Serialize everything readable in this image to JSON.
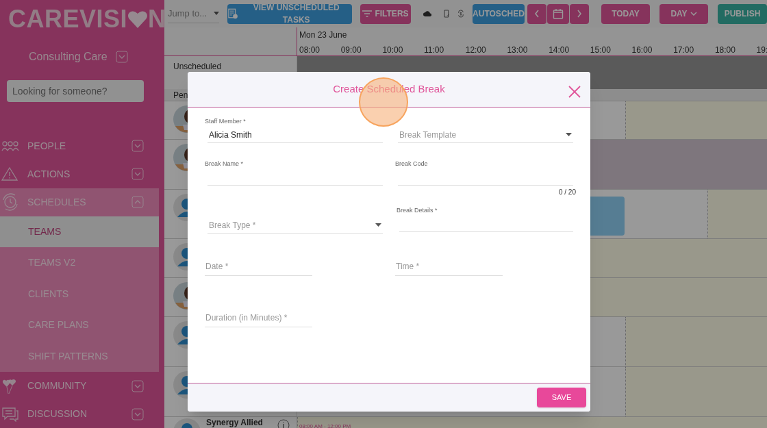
{
  "logo": {
    "before": "CAREVISI",
    "after": "N"
  },
  "organisation": "Consulting Care",
  "search": {
    "placeholder": "Looking for someone?"
  },
  "sidebar": {
    "items": [
      {
        "label": "PEOPLE",
        "kind": "people",
        "expanded": false
      },
      {
        "label": "ACTIONS",
        "kind": "warning",
        "expanded": false
      },
      {
        "label": "SCHEDULES",
        "kind": "clock",
        "expanded": true,
        "children": [
          {
            "label": "TEAMS",
            "selected": true
          },
          {
            "label": "TEAMS V2",
            "selected": false
          },
          {
            "label": "CLIENTS",
            "selected": false
          },
          {
            "label": "CARE PLANS",
            "selected": false
          },
          {
            "label": "SHIFT PATTERNS",
            "selected": false
          }
        ]
      },
      {
        "label": "COMMUNITY",
        "kind": "balloon",
        "expanded": false
      },
      {
        "label": "DISCUSSION",
        "kind": "chat",
        "expanded": false
      }
    ]
  },
  "toolbar": {
    "jump": {
      "placeholder": "Jump to..."
    },
    "unscheduled": "VIEW UNSCHEDULED TASKS",
    "filters": "FILTERS",
    "autosched": "AUTOSCHED",
    "today": "TODAY",
    "view": "DAY",
    "publish": "PUBLISH"
  },
  "schedule": {
    "date": "Mon 23 June",
    "hours": [
      "08:00",
      "09:00",
      "10:00",
      "11:00",
      "12:00",
      "13:00",
      "14:00",
      "15:00",
      "16:00",
      "17:00",
      "18:00",
      "19:"
    ],
    "unscheduled": "Unscheduled",
    "pending": "Pen",
    "rows": [
      {
        "lane": {
          "kind": "open"
        }
      },
      {
        "lane": {
          "kind": "leave"
        }
      },
      {
        "avatar": {
          "kind": "generic"
        },
        "lane": {
          "kind": "shift"
        }
      },
      {
        "avatar": {
          "kind": "generic"
        },
        "lane": {
          "kind": "available"
        }
      },
      {
        "lane": {
          "kind": "available"
        }
      },
      {
        "avatar": {
          "kind": "generic"
        },
        "lane": {
          "kind": "open"
        }
      },
      {
        "avatar": {
          "kind": "generic"
        },
        "lane": {
          "kind": "open"
        }
      },
      {
        "avatar": {
          "kind": "generic"
        },
        "lane": {
          "kind": "available"
        },
        "name": "Synergy Allied",
        "time": "08:00 AM - 12:00 PM"
      }
    ]
  },
  "dialog": {
    "title": "Create Scheduled Break",
    "save": "SAVE",
    "fields": [
      {
        "kind": "text",
        "label": "Staff Member *",
        "value": "Alicia Smith"
      },
      {
        "kind": "select",
        "placeholder": "Break Template"
      },
      {
        "kind": "text",
        "label": "Break Name *"
      },
      {
        "kind": "text",
        "label": "Break Code",
        "counter": "0 / 20"
      },
      {
        "kind": "text",
        "label": "Break Details *"
      },
      {
        "kind": "select",
        "placeholder": "Break Type *"
      },
      {
        "kind": "input",
        "placeholder": "Date *"
      },
      {
        "kind": "input",
        "placeholder": "Time *"
      },
      {
        "kind": "input",
        "placeholder": "Duration (in Minutes) *"
      }
    ]
  }
}
